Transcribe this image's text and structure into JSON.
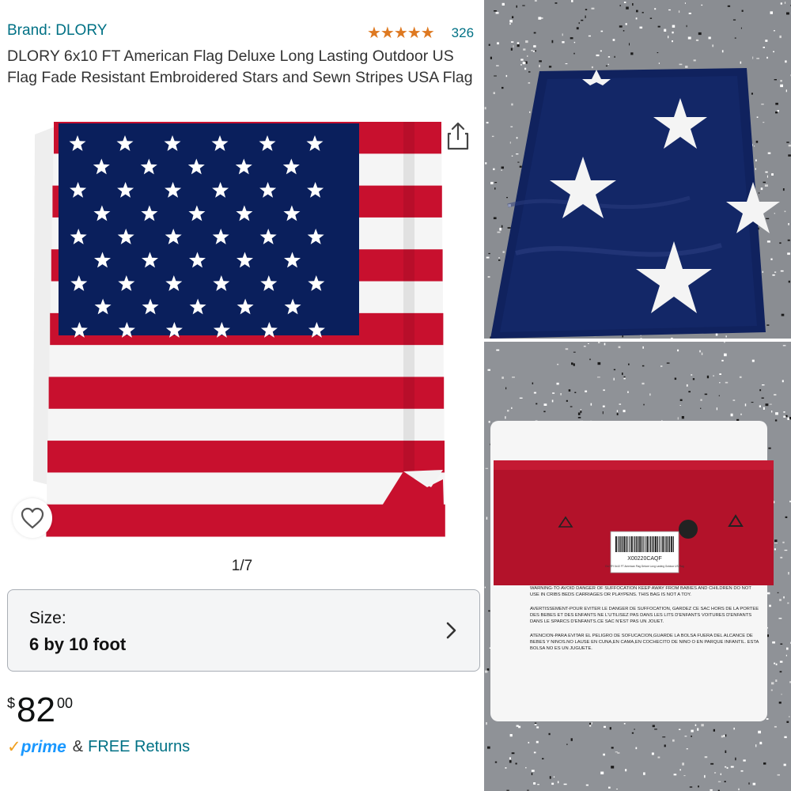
{
  "product": {
    "brand": "Brand: DLORY",
    "rating_stars": "★★★★★",
    "rating_value": 4.5,
    "rating_count": "326",
    "title": "DLORY 6x10 FT American Flag Deluxe Long Lasting Outdoor US Flag Fade Resistant Embroidered Stars and Sewn Stripes USA Flag"
  },
  "gallery": {
    "pager": "1/7"
  },
  "size": {
    "label": "Size:",
    "value": "6 by 10 foot"
  },
  "price": {
    "symbol": "$",
    "whole": "82",
    "fraction": "00"
  },
  "delivery": {
    "check": "✓",
    "prime": "prime",
    "amp": "&",
    "free_returns": "FREE Returns"
  },
  "package_label": {
    "code": "X00220CAQF",
    "desc": "DLORY 6x10 FT American Flag Deluxe Long Lasting Outdoor US Flag",
    "warning_en": "WARNING-TO AVOID DANGER OF SUFFOCATION KEEP AWAY FROM BABIES AND CHILDREN DO NOT USE IN CRIBS BEDS CARRIAGES OR PLAYPENS. THIS BAG IS NOT A TOY.",
    "warning_fr": "AVERTISSEMENT-POUR EVITER LE DANGER DE SUFFOCATION, GARDEZ CE SAC HORS DE LA PORTEE DES BEBES ET DES ENFANTS NE L'UTILISEZ PAS DANS LES LITS D'ENFANTS VOITURES D'ENFANTS DANS LE SPARCS D'ENFANTS.CE SAC N'EST PAS UN JOUET.",
    "warning_es": "ATENCION-PARA EVITAR EL PELIGRO DE SOFUCACION,GUARDE LA BOLSA FUERA DEL ALCANCE DE BEBES Y NINOS.NO LAUSE EN CUNA,EN CAMA,EN COCHECITO DE NINO O EN PARQUE INFANTIL. ESTA BOLSA NO ES UN JUGUETE."
  },
  "colors": {
    "link": "#007185",
    "star": "#de7921",
    "prime_blue": "#1a98ff",
    "prime_check": "#f0a020",
    "flag_red": "#c8102e",
    "flag_blue": "#0a1f5c"
  },
  "icons": {
    "share": "share-icon",
    "wishlist": "heart-icon",
    "chevron": "chevron-right-icon"
  }
}
